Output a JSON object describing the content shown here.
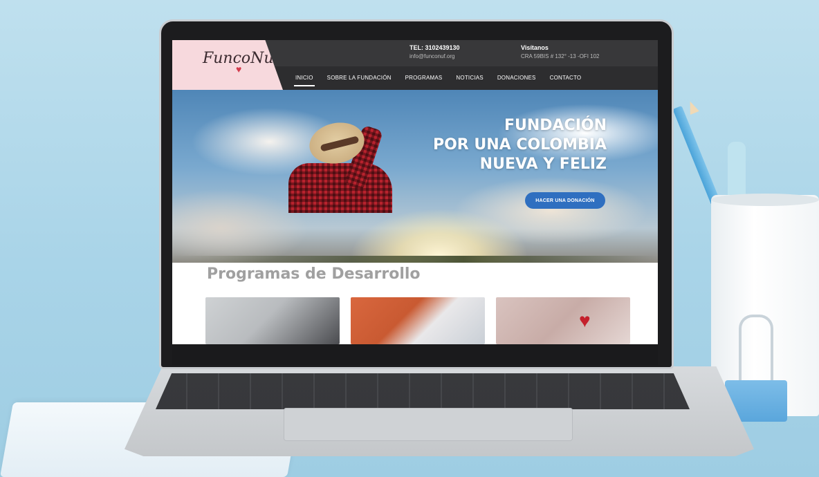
{
  "site": {
    "logo_text": "FuncoNuF",
    "contact_phone_label": "TEL: 3102439130",
    "contact_email": "info@funconuf.org",
    "visit_label": "Visítanos",
    "visit_address": "CRA 59BIS # 132° -13 -OFI 102"
  },
  "nav": {
    "items": [
      {
        "label": "INICIO"
      },
      {
        "label": "SOBRE LA FUNDACIÓN"
      },
      {
        "label": "PROGRAMAS"
      },
      {
        "label": "NOTICIAS"
      },
      {
        "label": "DONACIONES"
      },
      {
        "label": "CONTACTO"
      }
    ]
  },
  "hero": {
    "title_line1": "FUNDACIÓN",
    "title_line2": "POR UNA COLOMBIA",
    "title_line3": "NUEVA Y FELIZ",
    "cta_label": "HACER UNA DONACIÓN"
  },
  "programs": {
    "section_title": "Programas de Desarrollo"
  },
  "colors": {
    "accent_button": "#2f6fc0",
    "logo_background": "#f7d9dd",
    "header_background": "#2d2d2f"
  }
}
